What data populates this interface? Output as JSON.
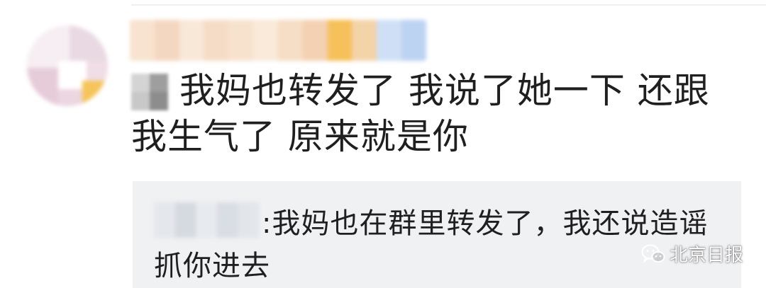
{
  "comment": {
    "author_blurred": true,
    "text": "我妈也转发了 我说了她一下 还跟我生气了 原来就是你"
  },
  "reply": {
    "separator": ":",
    "text": "我妈也在群里转发了，我还说造谣抓你进去"
  },
  "watermark": {
    "icon": "wechat-icon",
    "text": "北京日报"
  },
  "colors": {
    "text": "#1f1f1f",
    "reply_bg": "#f0f1f3",
    "background": "#ffffff"
  }
}
